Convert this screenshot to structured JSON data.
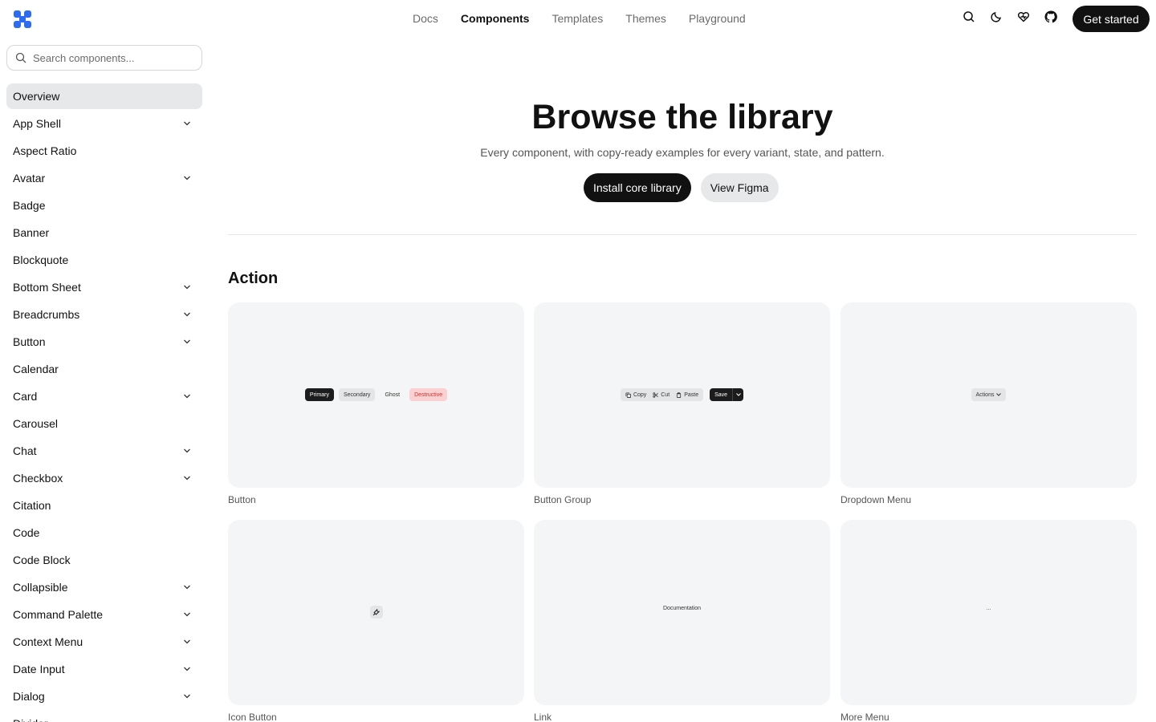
{
  "header": {
    "nav": [
      "Docs",
      "Components",
      "Templates",
      "Themes",
      "Playground"
    ],
    "active_nav": "Components",
    "cta_label": "Get started",
    "icons": [
      "search-icon",
      "moon-icon",
      "heart-icon",
      "github-icon"
    ]
  },
  "sidebar": {
    "search_placeholder": "Search components...",
    "items": [
      {
        "label": "Overview",
        "expandable": false,
        "active": true
      },
      {
        "label": "App Shell",
        "expandable": true
      },
      {
        "label": "Aspect Ratio",
        "expandable": false
      },
      {
        "label": "Avatar",
        "expandable": true
      },
      {
        "label": "Badge",
        "expandable": false
      },
      {
        "label": "Banner",
        "expandable": false
      },
      {
        "label": "Blockquote",
        "expandable": false
      },
      {
        "label": "Bottom Sheet",
        "expandable": true
      },
      {
        "label": "Breadcrumbs",
        "expandable": true
      },
      {
        "label": "Button",
        "expandable": true
      },
      {
        "label": "Calendar",
        "expandable": false
      },
      {
        "label": "Card",
        "expandable": true
      },
      {
        "label": "Carousel",
        "expandable": false
      },
      {
        "label": "Chat",
        "expandable": true
      },
      {
        "label": "Checkbox",
        "expandable": true
      },
      {
        "label": "Citation",
        "expandable": false
      },
      {
        "label": "Code",
        "expandable": false
      },
      {
        "label": "Code Block",
        "expandable": false
      },
      {
        "label": "Collapsible",
        "expandable": true
      },
      {
        "label": "Command Palette",
        "expandable": true
      },
      {
        "label": "Context Menu",
        "expandable": true
      },
      {
        "label": "Date Input",
        "expandable": true
      },
      {
        "label": "Dialog",
        "expandable": true
      },
      {
        "label": "Divider",
        "expandable": false
      }
    ]
  },
  "hero": {
    "title": "Browse the library",
    "subtitle": "Every component, with copy-ready examples for every variant, state, and pattern.",
    "primary_label": "Install core library",
    "secondary_label": "View Figma"
  },
  "section": {
    "title": "Action",
    "cards": [
      {
        "caption": "Button",
        "preview": {
          "buttons": [
            "Primary",
            "Secondary",
            "Ghost",
            "Destructive"
          ]
        }
      },
      {
        "caption": "Button Group",
        "preview": {
          "group": [
            "Copy",
            "Cut",
            "Paste"
          ],
          "split": "Save"
        }
      },
      {
        "caption": "Dropdown Menu",
        "preview": {
          "trigger": "Actions"
        }
      },
      {
        "caption": "Icon Button",
        "preview": {
          "icon": "wrench-icon"
        }
      },
      {
        "caption": "Link",
        "preview": {
          "text": "Documentation"
        }
      },
      {
        "caption": "More Menu",
        "preview": {
          "text": "..."
        }
      }
    ]
  },
  "colors": {
    "primary": "#111111",
    "surface": "#f4f5f6",
    "active_bg": "#e7e8ea",
    "destructive_bg": "#fbd0d0",
    "destructive_text": "#d03030",
    "logo": "#2b6cf0"
  }
}
